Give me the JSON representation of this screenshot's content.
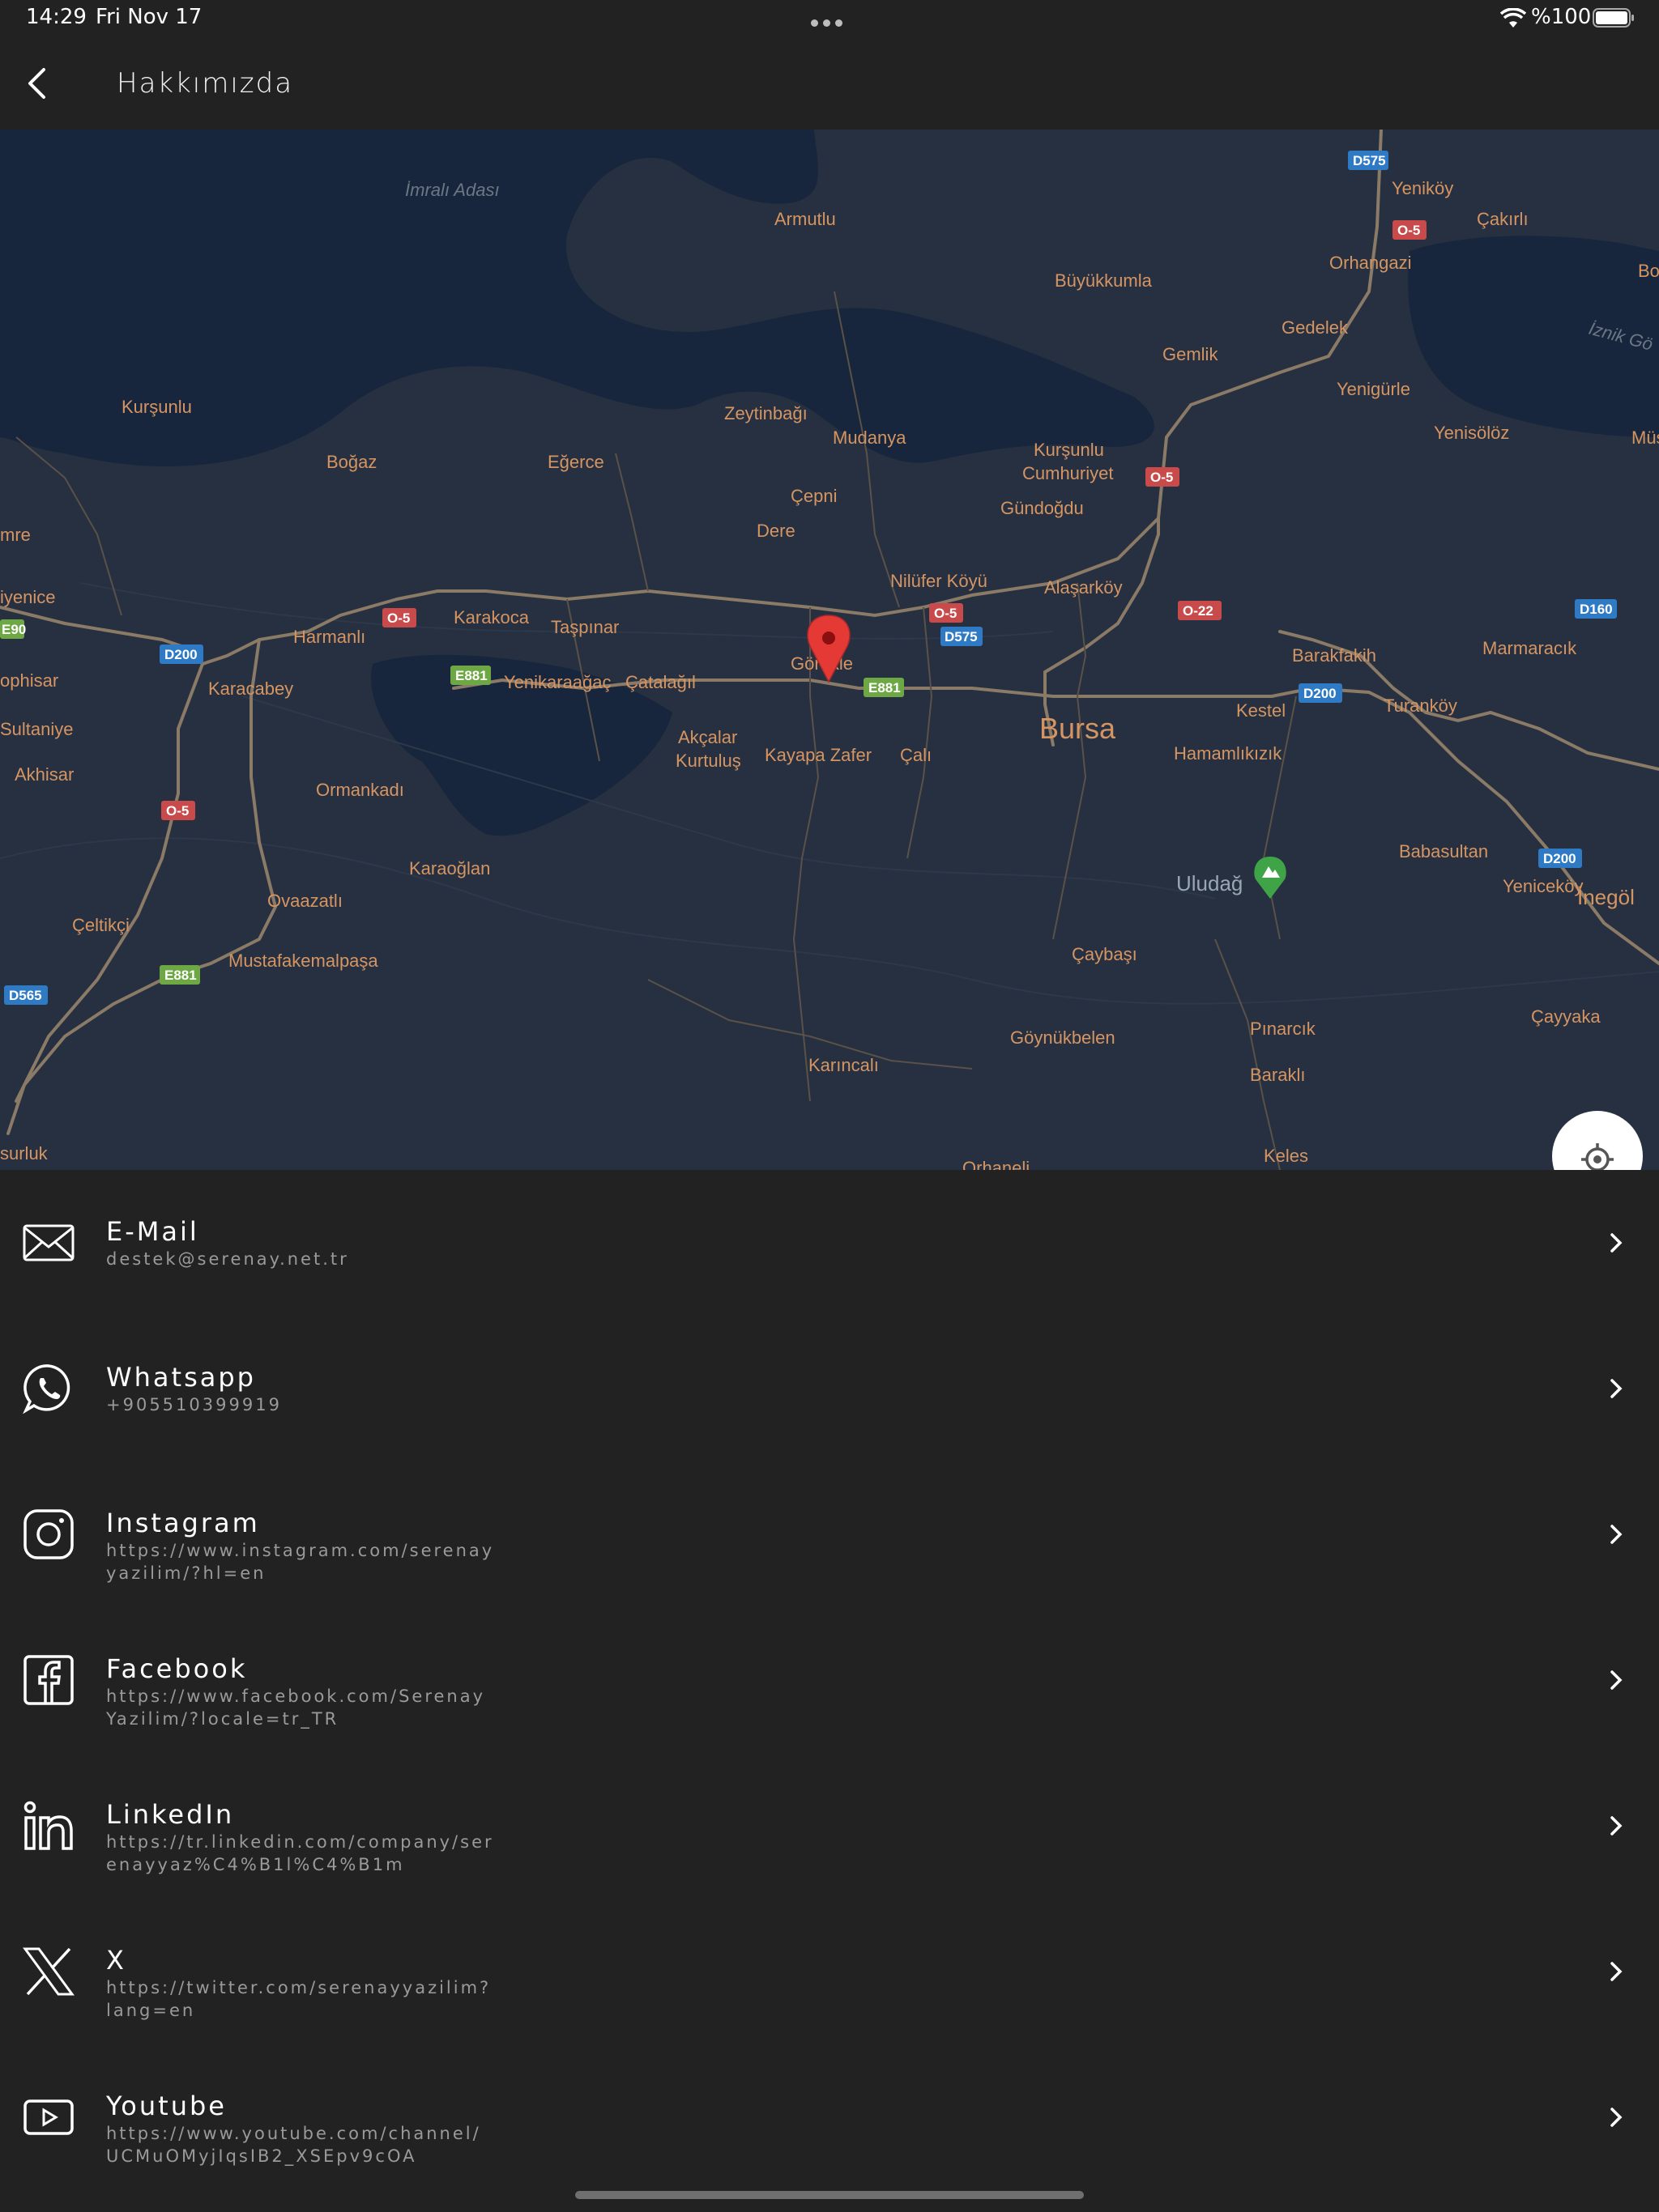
{
  "status_bar": {
    "time": "14:29",
    "date": "Fri Nov 17",
    "battery": "%100"
  },
  "header": {
    "title": "Hakkımızda"
  },
  "map": {
    "water_labels": [
      "İmralı Adası",
      "İznik Gö"
    ],
    "places": [
      "Armutlu",
      "Yeniköy",
      "Çakırlı",
      "Orhangazi",
      "Boz",
      "Büyükkumla",
      "Gemlik",
      "Gedelek",
      "Yenigürle",
      "Yenisölöz",
      "Müşk",
      "Kurşunlu",
      "Zeytinbağı",
      "Mudanya",
      "Kurşunlu",
      "Cumhuriyet",
      "Boğaz",
      "Eğerce",
      "Çepni",
      "Gündoğdu",
      "Dere",
      "mre",
      "Nilüfer Köyü",
      "Alaşarköy",
      "iyenice",
      "Harmanlı",
      "Karakoca",
      "Taşpınar",
      "Barakfakih",
      "Marmaracık",
      "ophisar",
      "Karacabey",
      "Yenikaraağaç",
      "Çatalağıl",
      "Görükle",
      "Kestel",
      "Turanköy",
      "Sultaniye",
      "Akçalar",
      "Kurtuluş",
      "Kayapa Zafer",
      "Çalı",
      "Hamamlıkızık",
      "Akhisar",
      "Ormankadı",
      "Babasultan",
      "Yeniceköy",
      "İnegöl",
      "Karaoğlan",
      "Uludağ",
      "Ovaazatlı",
      "Çeltikçi",
      "Çaybaşı",
      "Mustafakemalpaşa",
      "Pınarcık",
      "Çayyaka",
      "Göynükbelen",
      "Baraklı",
      "Karıncalı",
      "surluk",
      "Keles",
      "Orhaneli"
    ],
    "city": "Bursa",
    "road_shields": [
      "D575",
      "O-5",
      "O-5",
      "O-5",
      "O-5",
      "O-22",
      "D160",
      "E90",
      "D200",
      "D575",
      "E881",
      "E881",
      "D200",
      "O-5",
      "D200",
      "E881",
      "D565"
    ]
  },
  "contacts": [
    {
      "label": "E-Mail",
      "value": "destek@serenay.net.tr",
      "icon": "envelope-icon"
    },
    {
      "label": "Whatsapp",
      "value": "+905510399919",
      "icon": "whatsapp-icon"
    },
    {
      "label": "Instagram",
      "value": "https://www.instagram.com/serenayyazilim/?hl=en",
      "icon": "instagram-icon"
    },
    {
      "label": "Facebook",
      "value": "https://www.facebook.com/SerenayYazilim/?locale=tr_TR",
      "icon": "facebook-icon"
    },
    {
      "label": "LinkedIn",
      "value": "https://tr.linkedin.com/company/serenayyaz%C4%B1l%C4%B1m",
      "icon": "linkedin-icon"
    },
    {
      "label": "X",
      "value": "https://twitter.com/serenayyazilim?lang=en",
      "icon": "x-icon"
    },
    {
      "label": "Youtube",
      "value": "https://www.youtube.com/channel/UCMuOMyjIqsIB2_XSEpv9cOA",
      "icon": "youtube-icon"
    }
  ],
  "colors": {
    "background": "#222222",
    "map_land": "#263040",
    "map_water": "#17263c",
    "map_label": "#d59563",
    "pin": "#e53935"
  }
}
